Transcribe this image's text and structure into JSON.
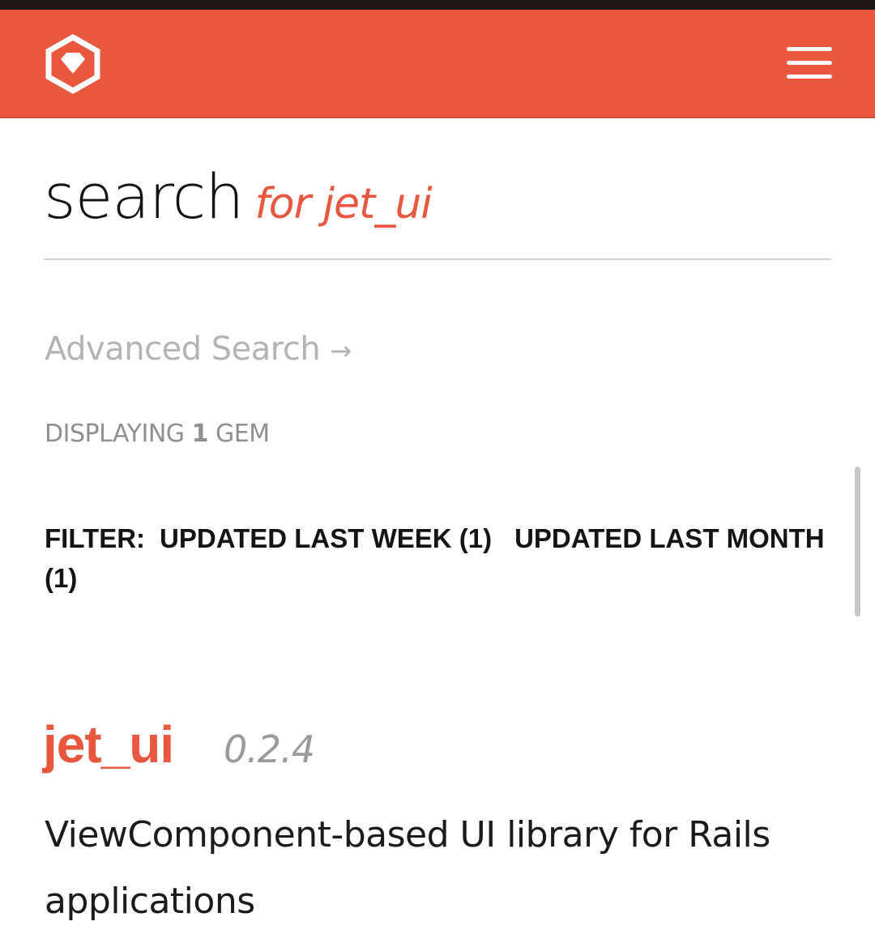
{
  "colors": {
    "brand": "#e9573f",
    "status_bar": "#1f1514",
    "muted_text": "#b3b3b3",
    "dark_text": "#141414"
  },
  "header": {
    "logo_icon": "rubygems-hexagon-logo-icon",
    "menu_icon": "hamburger-menu-icon"
  },
  "search": {
    "title": "search",
    "query_label": "for jet_ui"
  },
  "advanced_search": {
    "label": "Advanced Search",
    "arrow": "→"
  },
  "results_count": {
    "prefix": "DISPLAYING",
    "count": "1",
    "suffix": "GEM"
  },
  "filter": {
    "label": "FILTER:",
    "options": [
      "UPDATED LAST WEEK (1)",
      "UPDATED LAST MONTH (1)"
    ]
  },
  "gems": [
    {
      "name": "jet_ui",
      "version": "0.2.4",
      "description": "ViewComponent-based UI library for Rails applications"
    }
  ]
}
